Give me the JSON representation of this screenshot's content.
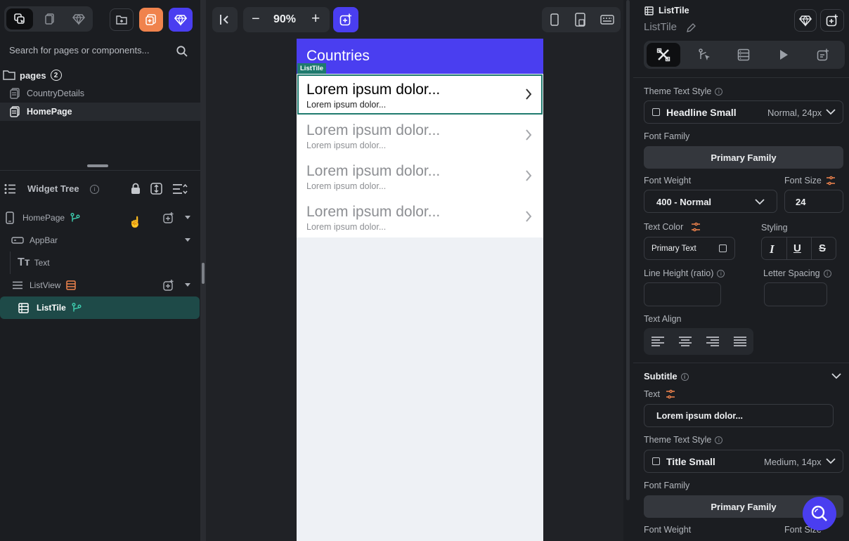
{
  "left": {
    "search_placeholder": "Search for pages or components...",
    "pages_label": "pages",
    "pages_count": "2",
    "pages": [
      "CountryDetails",
      "HomePage"
    ],
    "widget_tree_title": "Widget Tree",
    "tree": {
      "homepage": "HomePage",
      "appbar": "AppBar",
      "text": "Text",
      "listview": "ListView",
      "listtile": "ListTile"
    }
  },
  "toolbar": {
    "zoom": "90%",
    "minus": "−",
    "plus": "+"
  },
  "canvas": {
    "appbar_title": "Countries",
    "selected_tag": "ListTile",
    "tiles": [
      {
        "title": "Lorem ipsum dolor...",
        "subtitle": "Lorem ipsum dolor..."
      },
      {
        "title": "Lorem ipsum dolor...",
        "subtitle": "Lorem ipsum dolor..."
      },
      {
        "title": "Lorem ipsum dolor...",
        "subtitle": "Lorem ipsum dolor..."
      },
      {
        "title": "Lorem ipsum dolor...",
        "subtitle": "Lorem ipsum dolor..."
      }
    ]
  },
  "props": {
    "widget_type": "ListTile",
    "widget_name": "ListTile",
    "title_section": {
      "theme_text_style_label": "Theme Text Style",
      "theme_text_style": "Headline Small",
      "theme_text_style_meta": "Normal, 24px",
      "font_family_label": "Font Family",
      "font_family": "Primary Family",
      "font_weight_label": "Font Weight",
      "font_weight": "400 - Normal",
      "font_size_label": "Font Size",
      "font_size": "24",
      "text_color_label": "Text Color",
      "text_color": "Primary Text",
      "styling_label": "Styling",
      "line_height_label": "Line Height (ratio)",
      "letter_spacing_label": "Letter Spacing",
      "text_align_label": "Text Align"
    },
    "subtitle_section": {
      "heading": "Subtitle",
      "text_label": "Text",
      "text_value": "Lorem ipsum dolor...",
      "theme_text_style_label": "Theme Text Style",
      "theme_text_style": "Title Small",
      "theme_text_style_meta": "Medium, 14px",
      "font_family_label": "Font Family",
      "font_family": "Primary Family",
      "font_weight_label": "Font Weight",
      "font_size_label": "Font Size"
    }
  },
  "colors": {
    "accent": "#4a3ef0",
    "orange": "#f0834d",
    "teal": "#1f7a6e",
    "selected_row": "#1e4a48"
  }
}
